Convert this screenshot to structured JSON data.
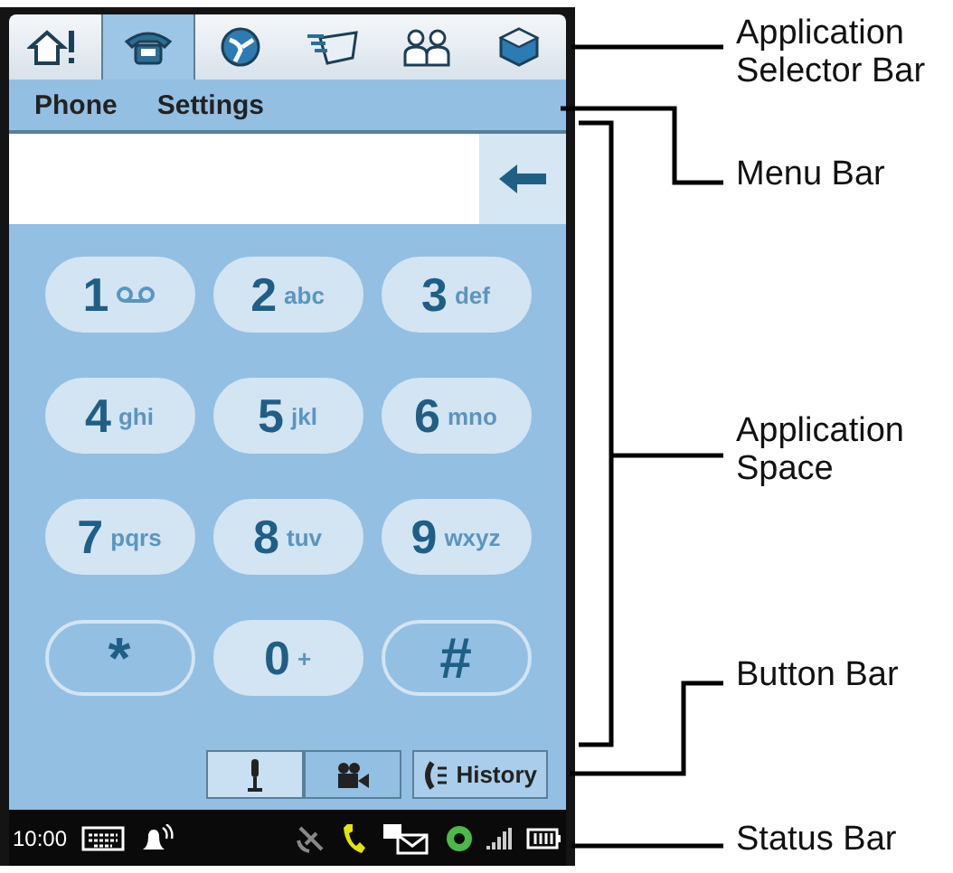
{
  "app_selector_bar": {
    "tabs": [
      {
        "kind": "home",
        "selected": false
      },
      {
        "kind": "phone",
        "selected": true
      },
      {
        "kind": "globe",
        "selected": false
      },
      {
        "kind": "messaging",
        "selected": false
      },
      {
        "kind": "contacts",
        "selected": false
      },
      {
        "kind": "box",
        "selected": false
      }
    ]
  },
  "menu_bar": {
    "items": [
      "Phone",
      "Settings"
    ]
  },
  "keypad": {
    "keys": [
      {
        "kind": "voicemail",
        "digit": "1"
      },
      {
        "kind": "digit",
        "digit": "2",
        "letters": "abc"
      },
      {
        "kind": "digit",
        "digit": "3",
        "letters": "def"
      },
      {
        "kind": "digit",
        "digit": "4",
        "letters": "ghi"
      },
      {
        "kind": "digit",
        "digit": "5",
        "letters": "jkl"
      },
      {
        "kind": "digit",
        "digit": "6",
        "letters": "mno"
      },
      {
        "kind": "digit",
        "digit": "7",
        "letters": "pqrs"
      },
      {
        "kind": "digit",
        "digit": "8",
        "letters": "tuv"
      },
      {
        "kind": "digit",
        "digit": "9",
        "letters": "wxyz"
      },
      {
        "kind": "symbol",
        "digit": "*"
      },
      {
        "kind": "digit",
        "digit": "0",
        "letters": "+"
      },
      {
        "kind": "symbol",
        "digit": "#"
      }
    ]
  },
  "button_bar": {
    "modes": [
      {
        "kind": "microphone",
        "selected": true
      },
      {
        "kind": "video",
        "selected": false
      }
    ],
    "history_button": "History"
  },
  "status_bar": {
    "time": "10:00"
  },
  "callouts": [
    "Application Selector Bar",
    "Menu Bar",
    "Application Space",
    "Button Bar",
    "Status Bar"
  ]
}
